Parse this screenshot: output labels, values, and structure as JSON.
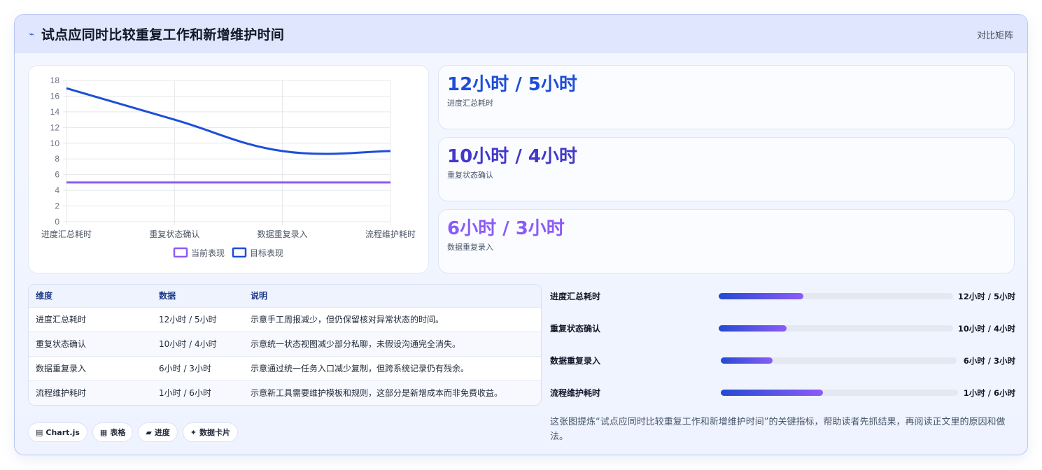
{
  "header": {
    "icon": "sparkline-icon",
    "title": "试点应同时比较重复工作和新增维护时间",
    "right_label": "对比矩阵"
  },
  "chart_data": {
    "type": "line",
    "categories": [
      "进度汇总耗时",
      "重复状态确认",
      "数据重复录入",
      "流程维护耗时"
    ],
    "series": [
      {
        "name": "当前表现",
        "values": [
          5,
          5,
          5,
          5
        ],
        "color": "#8b5cf6"
      },
      {
        "name": "目标表现",
        "values": [
          17,
          13,
          9,
          9
        ],
        "color": "#1d4ed8"
      }
    ],
    "ylim": [
      0,
      18
    ],
    "yticks": [
      0,
      2,
      4,
      6,
      8,
      10,
      12,
      14,
      16,
      18
    ],
    "grid": true,
    "legend": "bottom"
  },
  "stats": [
    {
      "value": "12小时 / 5小时",
      "label": "进度汇总耗时",
      "color": "#1d4ed8"
    },
    {
      "value": "10小时 / 4小时",
      "label": "重复状态确认",
      "color": "#4338ca"
    },
    {
      "value": "6小时 / 3小时",
      "label": "数据重复录入",
      "color": "#8b5cf6"
    }
  ],
  "table": {
    "headers": [
      "维度",
      "数据",
      "说明"
    ],
    "rows": [
      [
        "进度汇总耗时",
        "12小时 / 5小时",
        "示意手工周报减少，但仍保留核对异常状态的时间。"
      ],
      [
        "重复状态确认",
        "10小时 / 4小时",
        "示意统一状态视图减少部分私聊，未假设沟通完全消失。"
      ],
      [
        "数据重复录入",
        "6小时 / 3小时",
        "示意通过统一任务入口减少复制，但跨系统记录仍有残余。"
      ],
      [
        "流程维护耗时",
        "1小时 / 6小时",
        "示意新工具需要维护模板和规则，这部分是新增成本而非免费收益。"
      ]
    ]
  },
  "pills": [
    {
      "icon": "▤",
      "label": "Chart.js"
    },
    {
      "icon": "▦",
      "label": "表格"
    },
    {
      "icon": "▰",
      "label": "进度"
    },
    {
      "icon": "✦",
      "label": "数据卡片"
    }
  ],
  "progress": [
    {
      "label": "进度汇总耗时",
      "value": "12小时 / 5小时",
      "fraction": 0.36
    },
    {
      "label": "重复状态确认",
      "value": "10小时 / 4小时",
      "fraction": 0.29
    },
    {
      "label": "数据重复录入",
      "value": "6小时 / 3小时",
      "fraction": 0.22
    },
    {
      "label": "流程维护耗时",
      "value": "1小时 / 6小时",
      "fraction": 0.43
    }
  ],
  "note": "这张图提炼“试点应同时比较重复工作和新增维护时间”的关键指标，帮助读者先抓结果，再阅读正文里的原因和做法。"
}
